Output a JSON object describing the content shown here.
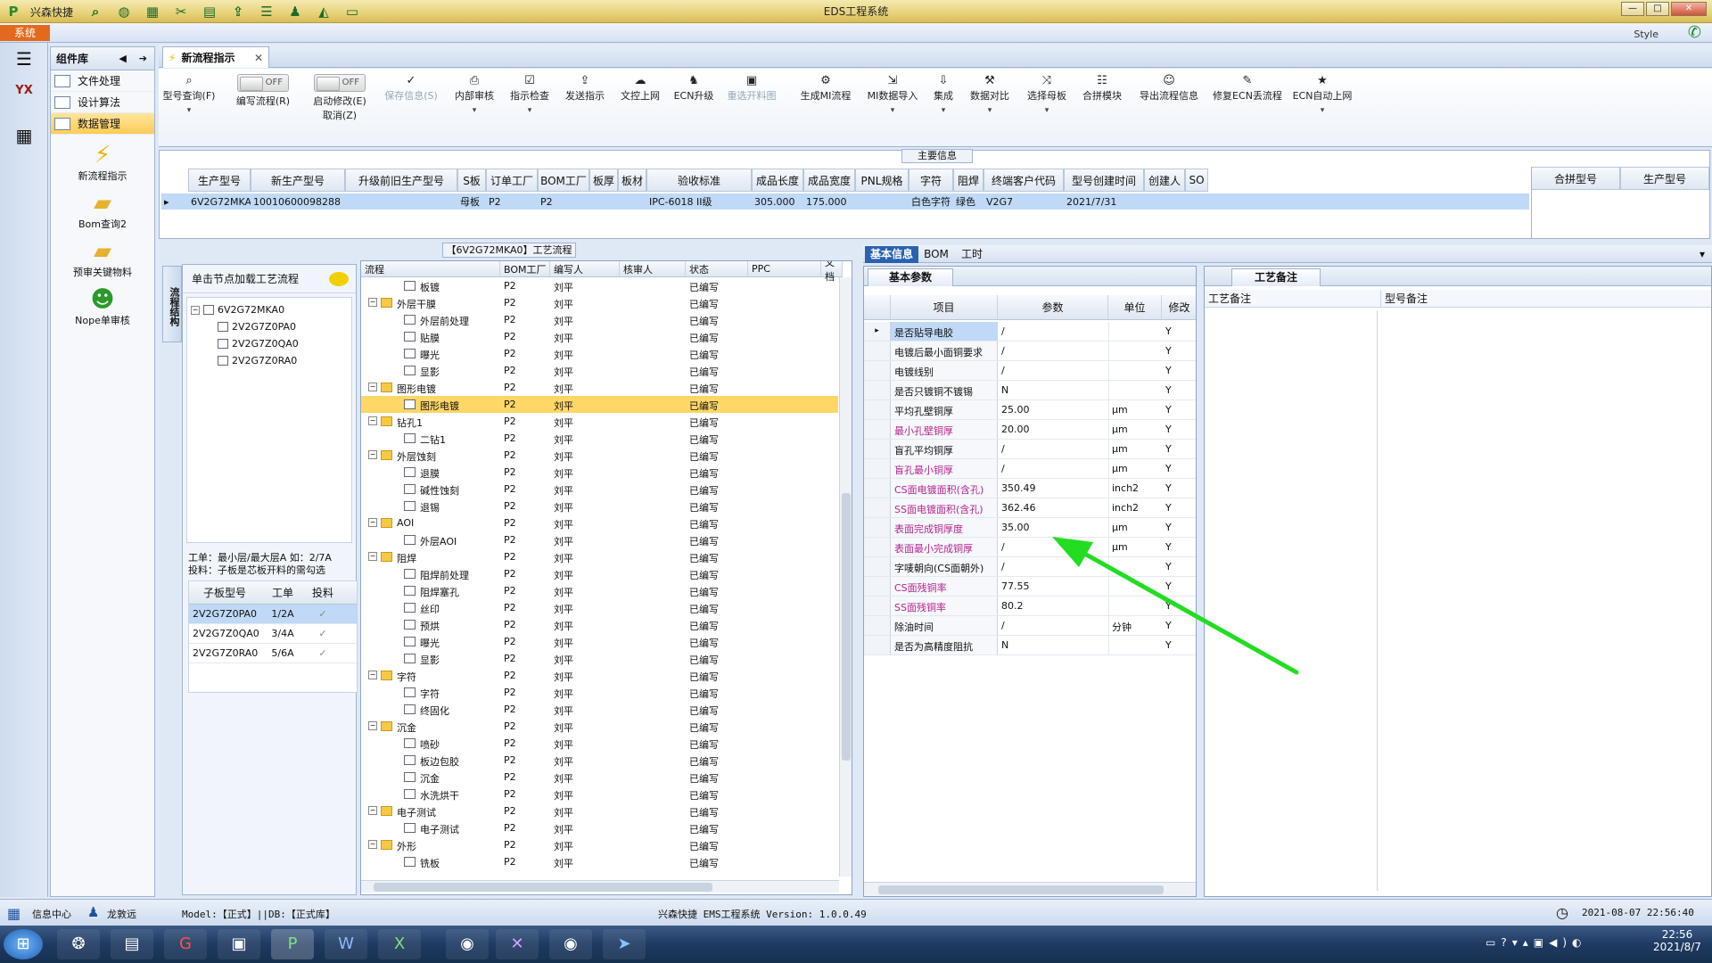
{
  "window": {
    "title": "EDS工程系统",
    "app_brand": "兴森快捷",
    "system_tab": "系统",
    "style_label": "Style"
  },
  "component_library": {
    "title": "组件库",
    "items": [
      {
        "label": "文件处理"
      },
      {
        "label": "设计算法"
      },
      {
        "label": "数据管理"
      }
    ],
    "big_items": [
      {
        "label": "新流程指示"
      },
      {
        "label": "Bom查询2"
      },
      {
        "label": "预审关键物料"
      },
      {
        "label": "Nope单审核"
      }
    ]
  },
  "doc_tab": {
    "label": "新流程指示"
  },
  "toolbar": {
    "model_query": "型号查询(F)",
    "write_flow": "编写流程(R)",
    "write_flow_toggle": "OFF",
    "start_modify": "启动修改(E)",
    "start_modify_toggle": "OFF",
    "cancel": "取消(Z)",
    "save_info": "保存信息(S)",
    "internal_review": "内部审核",
    "check": "指示检查",
    "publish": "发送指示",
    "upload": "文控上网",
    "ecn_upgrade": "ECN升级",
    "reselect_chart": "重选开料图",
    "gen_mi": "生成MI流程",
    "mi_import": "MI数据导入",
    "integrate": "集成",
    "compare": "数据对比",
    "select_mother": "选择母板",
    "merge_module": "合拼模块",
    "export_info": "导出流程信息",
    "fix_ecn": "修复ECN丢流程",
    "ecn_auto": "ECN自动上网"
  },
  "main_info": {
    "title": "主要信息",
    "columns": [
      "生产型号",
      "新生产型号",
      "升级前旧生产型号",
      "S板",
      "订单工厂",
      "BOM工厂",
      "板厚",
      "板材",
      "验收标准",
      "成品长度",
      "成品宽度",
      "PNL规格",
      "字符",
      "阻焊",
      "终端客户代码",
      "型号创建时间",
      "创建人",
      "SO"
    ],
    "row": [
      "6V2G72MKA0",
      "10010600098288",
      "",
      "母板",
      "P2",
      "P2",
      "",
      "",
      "IPC-6018 II级",
      "305.000",
      "175.000",
      "",
      "白色字符",
      "绿色",
      "V2G7",
      "2021/7/31",
      "",
      ""
    ],
    "merge_columns": [
      "合拼型号",
      "生产型号"
    ]
  },
  "process_panel": {
    "title": "【6V2G72MKA0】工艺流程",
    "side_tab": "流程结构",
    "load_hint": "单击节点加载工艺流程",
    "tree": {
      "root": "6V2G72MKA0",
      "children": [
        "2V2G7Z0PA0",
        "2V2G7Z0QA0",
        "2V2G7Z0RA0"
      ]
    },
    "note_line1": "工单：最小层/最大层A 如：2/7A",
    "note_line2": "投料：子板是芯板开料的需勾选",
    "sub_columns": [
      "子板型号",
      "工单",
      "投料"
    ],
    "sub_rows": [
      {
        "model": "2V2G7Z0PA0",
        "order": "1/2A",
        "feed": "✓"
      },
      {
        "model": "2V2G7Z0QA0",
        "order": "3/4A",
        "feed": "✓"
      },
      {
        "model": "2V2G7Z0RA0",
        "order": "5/6A",
        "feed": "✓"
      }
    ]
  },
  "process_grid": {
    "columns": [
      "流程",
      "BOM工厂",
      "编写人",
      "核审人",
      "状态",
      "PPC",
      "文档"
    ],
    "rows": [
      {
        "level": 2,
        "type": "doc",
        "name": "板镀",
        "factory": "P2",
        "writer": "刘平",
        "status": "已编写"
      },
      {
        "level": 1,
        "type": "folder",
        "name": "外层干膜",
        "factory": "P2",
        "writer": "刘平",
        "status": "已编写"
      },
      {
        "level": 2,
        "type": "doc",
        "name": "外层前处理",
        "factory": "P2",
        "writer": "刘平",
        "status": "已编写"
      },
      {
        "level": 2,
        "type": "doc",
        "name": "贴膜",
        "factory": "P2",
        "writer": "刘平",
        "status": "已编写"
      },
      {
        "level": 2,
        "type": "doc",
        "name": "曝光",
        "factory": "P2",
        "writer": "刘平",
        "status": "已编写"
      },
      {
        "level": 2,
        "type": "doc",
        "name": "显影",
        "factory": "P2",
        "writer": "刘平",
        "status": "已编写"
      },
      {
        "level": 1,
        "type": "folder",
        "name": "图形电镀",
        "factory": "P2",
        "writer": "刘平",
        "status": "已编写"
      },
      {
        "level": 2,
        "type": "doc",
        "name": "图形电镀",
        "factory": "P2",
        "writer": "刘平",
        "status": "已编写",
        "selected": true
      },
      {
        "level": 1,
        "type": "folder",
        "name": "钻孔1",
        "factory": "P2",
        "writer": "刘平",
        "status": "已编写"
      },
      {
        "level": 2,
        "type": "doc",
        "name": "二钻1",
        "factory": "P2",
        "writer": "刘平",
        "status": "已编写"
      },
      {
        "level": 1,
        "type": "folder",
        "name": "外层蚀刻",
        "factory": "P2",
        "writer": "刘平",
        "status": "已编写"
      },
      {
        "level": 2,
        "type": "doc",
        "name": "退膜",
        "factory": "P2",
        "writer": "刘平",
        "status": "已编写"
      },
      {
        "level": 2,
        "type": "doc",
        "name": "碱性蚀刻",
        "factory": "P2",
        "writer": "刘平",
        "status": "已编写"
      },
      {
        "level": 2,
        "type": "doc",
        "name": "退锡",
        "factory": "P2",
        "writer": "刘平",
        "status": "已编写"
      },
      {
        "level": 1,
        "type": "folder",
        "name": "AOI",
        "factory": "P2",
        "writer": "刘平",
        "status": "已编写"
      },
      {
        "level": 2,
        "type": "doc",
        "name": "外层AOI",
        "factory": "P2",
        "writer": "刘平",
        "status": "已编写"
      },
      {
        "level": 1,
        "type": "folder",
        "name": "阻焊",
        "factory": "P2",
        "writer": "刘平",
        "status": "已编写"
      },
      {
        "level": 2,
        "type": "doc",
        "name": "阻焊前处理",
        "factory": "P2",
        "writer": "刘平",
        "status": "已编写"
      },
      {
        "level": 2,
        "type": "doc",
        "name": "阻焊塞孔",
        "factory": "P2",
        "writer": "刘平",
        "status": "已编写"
      },
      {
        "level": 2,
        "type": "doc",
        "name": "丝印",
        "factory": "P2",
        "writer": "刘平",
        "status": "已编写"
      },
      {
        "level": 2,
        "type": "doc",
        "name": "预烘",
        "factory": "P2",
        "writer": "刘平",
        "status": "已编写"
      },
      {
        "level": 2,
        "type": "doc",
        "name": "曝光",
        "factory": "P2",
        "writer": "刘平",
        "status": "已编写"
      },
      {
        "level": 2,
        "type": "doc",
        "name": "显影",
        "factory": "P2",
        "writer": "刘平",
        "status": "已编写"
      },
      {
        "level": 1,
        "type": "folder",
        "name": "字符",
        "factory": "P2",
        "writer": "刘平",
        "status": "已编写"
      },
      {
        "level": 2,
        "type": "doc",
        "name": "字符",
        "factory": "P2",
        "writer": "刘平",
        "status": "已编写"
      },
      {
        "level": 2,
        "type": "doc",
        "name": "终固化",
        "factory": "P2",
        "writer": "刘平",
        "status": "已编写"
      },
      {
        "level": 1,
        "type": "folder",
        "name": "沉金",
        "factory": "P2",
        "writer": "刘平",
        "status": "已编写"
      },
      {
        "level": 2,
        "type": "doc",
        "name": "喷砂",
        "factory": "P2",
        "writer": "刘平",
        "status": "已编写"
      },
      {
        "level": 2,
        "type": "doc",
        "name": "板边包胶",
        "factory": "P2",
        "writer": "刘平",
        "status": "已编写"
      },
      {
        "level": 2,
        "type": "doc",
        "name": "沉金",
        "factory": "P2",
        "writer": "刘平",
        "status": "已编写"
      },
      {
        "level": 2,
        "type": "doc",
        "name": "水洗烘干",
        "factory": "P2",
        "writer": "刘平",
        "status": "已编写"
      },
      {
        "level": 1,
        "type": "folder",
        "name": "电子测试",
        "factory": "P2",
        "writer": "刘平",
        "status": "已编写"
      },
      {
        "level": 2,
        "type": "doc",
        "name": "电子测试",
        "factory": "P2",
        "writer": "刘平",
        "status": "已编写"
      },
      {
        "level": 1,
        "type": "folder",
        "name": "外形",
        "factory": "P2",
        "writer": "刘平",
        "status": "已编写"
      },
      {
        "level": 2,
        "type": "doc",
        "name": "铣板",
        "factory": "P2",
        "writer": "刘平",
        "status": "已编写"
      }
    ]
  },
  "right_tabs": {
    "basic": "基本信息",
    "bom": "BOM",
    "worktime": "工时"
  },
  "basic_params": {
    "tab": "基本参数",
    "columns": [
      "项目",
      "参数",
      "单位",
      "修改"
    ],
    "rows": [
      {
        "item": "是否贴导电胶",
        "value": "/",
        "unit": "",
        "mod": "Y",
        "hl": false
      },
      {
        "item": "电镀后最小面铜要求",
        "value": "/",
        "unit": "",
        "mod": "Y",
        "hl": false
      },
      {
        "item": "电镀线别",
        "value": "/",
        "unit": "",
        "mod": "Y",
        "hl": false
      },
      {
        "item": "是否只镀铜不镀锡",
        "value": "N",
        "unit": "",
        "mod": "Y",
        "hl": false
      },
      {
        "item": "平均孔壁铜厚",
        "value": "25.00",
        "unit": "μm",
        "mod": "Y",
        "hl": false
      },
      {
        "item": "最小孔壁铜厚",
        "value": "20.00",
        "unit": "μm",
        "mod": "Y",
        "hl": true
      },
      {
        "item": "盲孔平均铜厚",
        "value": "/",
        "unit": "μm",
        "mod": "Y",
        "hl": false
      },
      {
        "item": "盲孔最小铜厚",
        "value": "/",
        "unit": "μm",
        "mod": "Y",
        "hl": true
      },
      {
        "item": "CS面电镀面积(含孔)",
        "value": "350.49",
        "unit": "inch2",
        "mod": "Y",
        "hl": true
      },
      {
        "item": "SS面电镀面积(含孔)",
        "value": "362.46",
        "unit": "inch2",
        "mod": "Y",
        "hl": true
      },
      {
        "item": "表面完成铜厚度",
        "value": "35.00",
        "unit": "μm",
        "mod": "Y",
        "hl": true
      },
      {
        "item": "表面最小完成铜厚",
        "value": "/",
        "unit": "μm",
        "mod": "Y",
        "hl": true
      },
      {
        "item": "字唛朝向(CS面朝外)",
        "value": "/",
        "unit": "",
        "mod": "Y",
        "hl": false
      },
      {
        "item": "CS面残铜率",
        "value": "77.55",
        "unit": "",
        "mod": "Y",
        "hl": true
      },
      {
        "item": "SS面残铜率",
        "value": "80.2",
        "unit": "",
        "mod": "Y",
        "hl": true
      },
      {
        "item": "除油时间",
        "value": "/",
        "unit": "分钟",
        "mod": "Y",
        "hl": false
      },
      {
        "item": "是否为高精度阻抗",
        "value": "N",
        "unit": "",
        "mod": "Y",
        "hl": false
      }
    ]
  },
  "remarks": {
    "tab": "工艺备注",
    "col1": "工艺备注",
    "col2": "型号备注"
  },
  "status": {
    "info_center": "信息中心",
    "user": "龙敦远",
    "model_db": "Model:【正式】||DB:【正式库】",
    "version": "兴森快捷 EMS工程系统 Version: 1.0.0.49",
    "datetime": "2021-08-07 22:56:40"
  },
  "taskbar": {
    "time": "22:56",
    "date": "2021/8/7"
  },
  "colors": {
    "accent_orange": "#e36a1c",
    "selected_row": "#ffd766",
    "highlight_text": "#b4248c",
    "arrow": "#22dd22"
  }
}
